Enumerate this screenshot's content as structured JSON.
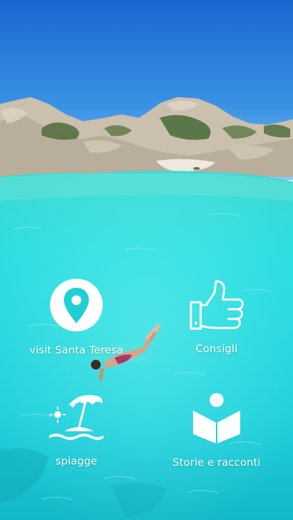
{
  "colors": {
    "sky_top": "#1f6fd6",
    "sky_bottom": "#7fc4f0",
    "water": "#22d6db",
    "water_deep": "#12bfd0",
    "rock": "#cfc2b0",
    "icon": "#ffffff"
  },
  "menu": {
    "items": [
      {
        "id": "visit",
        "label": "visit Santa Teresa",
        "icon": "location-pin-icon"
      },
      {
        "id": "tips",
        "label": "Consigli",
        "icon": "thumbs-up-icon"
      },
      {
        "id": "beaches",
        "label": "spiagge",
        "icon": "beach-umbrella-icon"
      },
      {
        "id": "stories",
        "label": "Storie e racconti",
        "icon": "reader-book-icon"
      }
    ]
  }
}
